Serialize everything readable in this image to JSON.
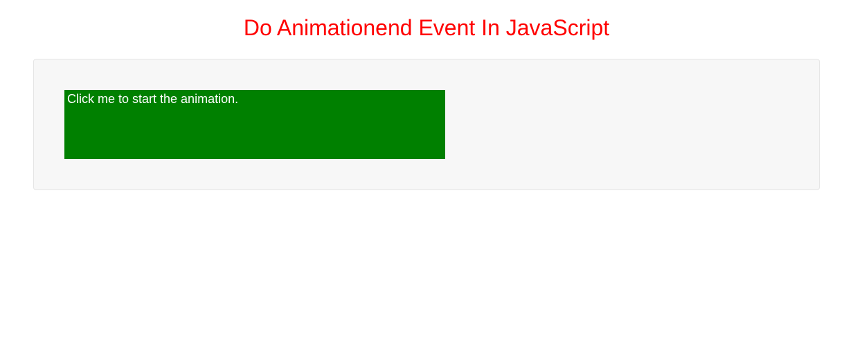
{
  "page": {
    "title": "Do Animationend Event In JavaScript"
  },
  "demo": {
    "box_text": "Click me to start the animation.",
    "box_color": "#008000"
  }
}
